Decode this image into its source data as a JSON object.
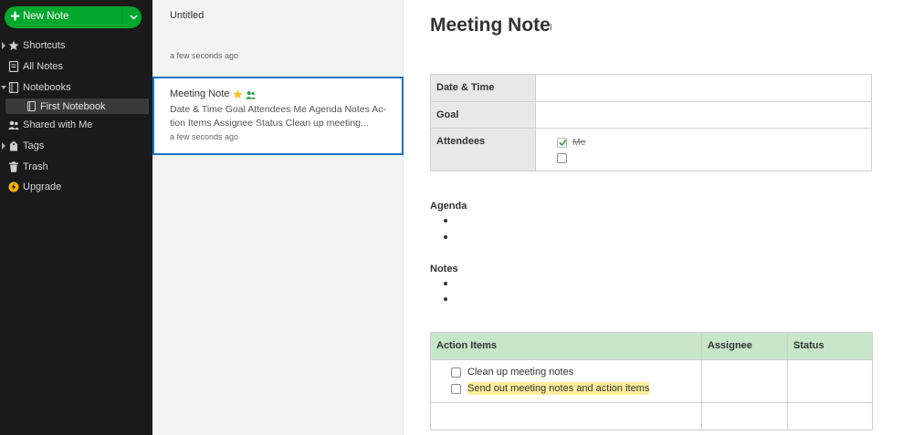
{
  "sidebar": {
    "new_note_label": "New Note",
    "items": [
      {
        "label": "Shortcuts"
      },
      {
        "label": "All Notes"
      },
      {
        "label": "Notebooks"
      },
      {
        "label": "First Notebook"
      },
      {
        "label": "Shared with Me"
      },
      {
        "label": "Tags"
      },
      {
        "label": "Trash"
      },
      {
        "label": "Upgrade"
      }
    ],
    "colors": {
      "accent": "#00a82d",
      "upgrade": "#f5b400"
    }
  },
  "notelist": {
    "notes": [
      {
        "title": "Untitled",
        "time": "a few seconds ago"
      },
      {
        "title": "Meeting Note",
        "snippet": "Date & Time Goal Attendees Me Agenda Notes Ac-tion Items Assignee Status Clean up meeting...",
        "time": "a few seconds ago"
      }
    ]
  },
  "editor": {
    "title": "Meeting Note",
    "cursor_glyph": "I",
    "info_table": {
      "date_time_label": "Date & Time",
      "goal_label": "Goal",
      "attendees_label": "Attendees",
      "attendees": [
        {
          "name": "Me",
          "checked": true
        },
        {
          "name": "",
          "checked": false
        }
      ]
    },
    "agenda_heading": "Agenda",
    "notes_heading": "Notes",
    "action_table": {
      "headers": [
        "Action Items",
        "Assignee",
        "Status"
      ],
      "tasks": [
        {
          "text": "Clean up meeting notes",
          "checked": false
        },
        {
          "text": "Send out meeting notes and action items",
          "checked": false,
          "highlighted": true
        }
      ]
    }
  }
}
